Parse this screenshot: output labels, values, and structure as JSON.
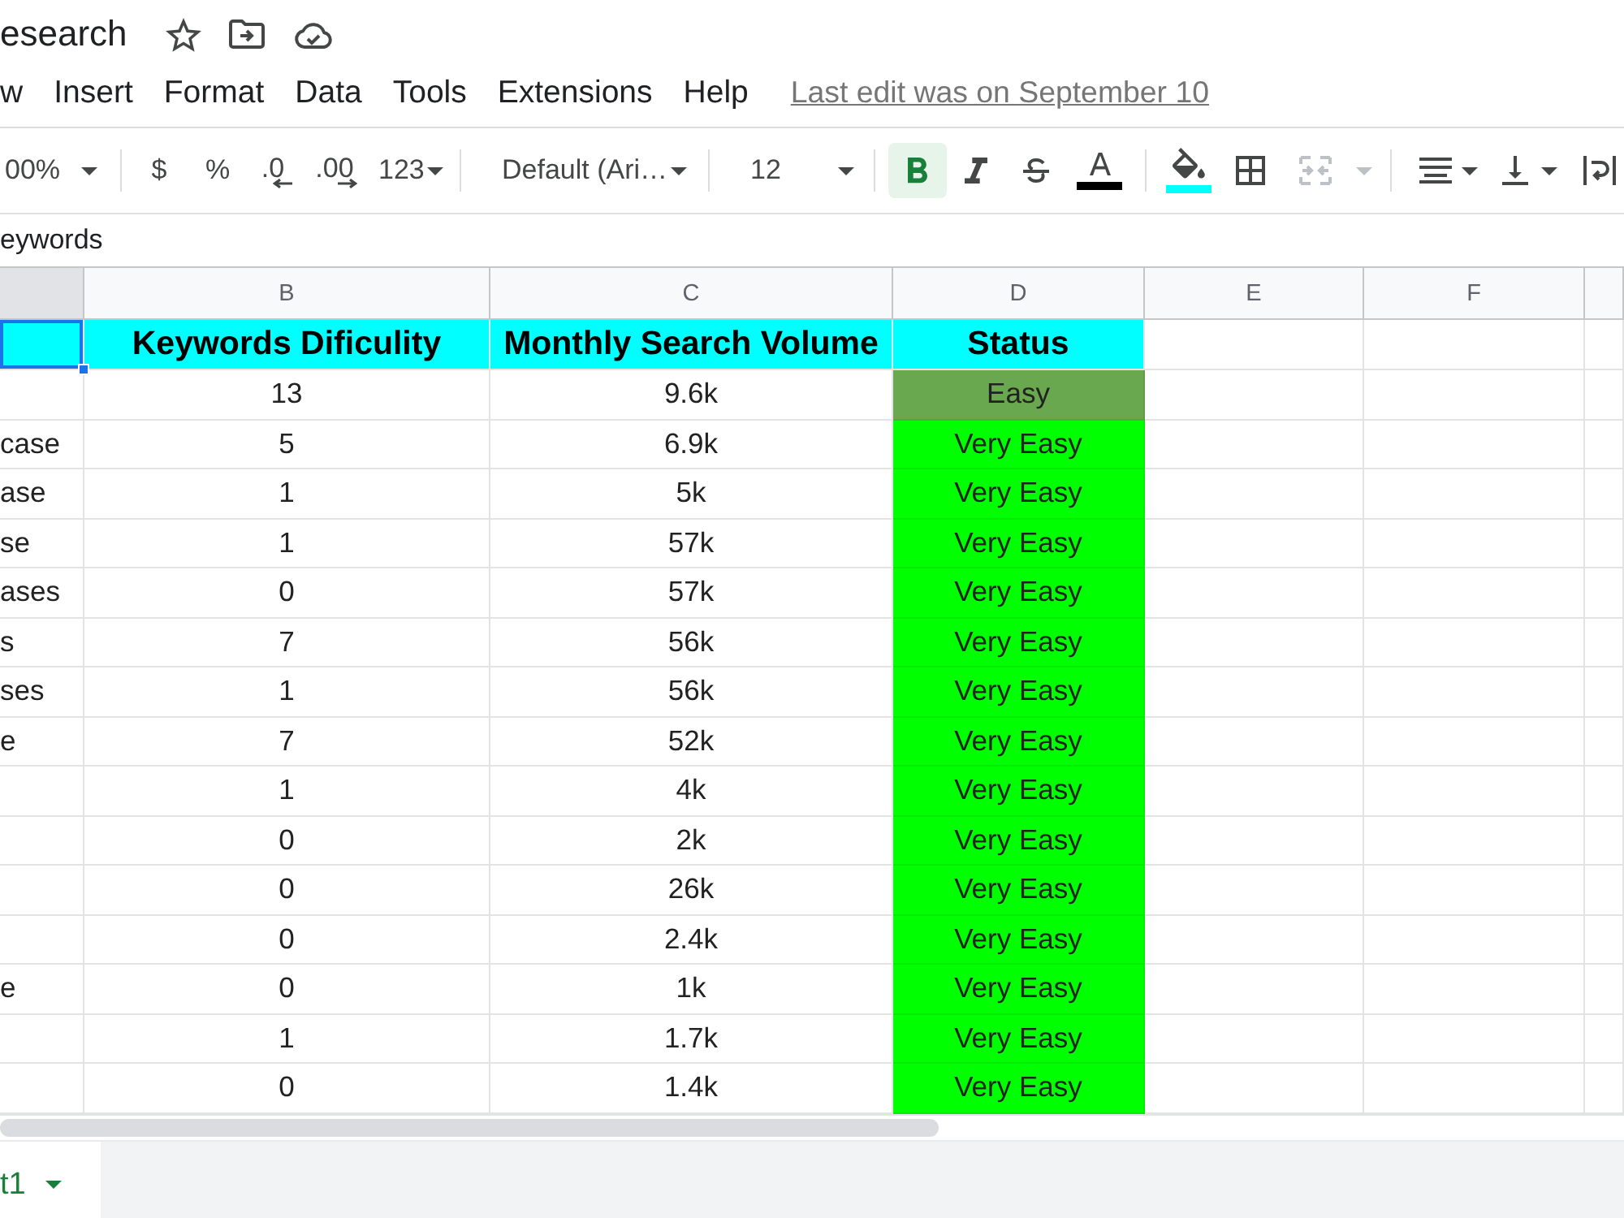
{
  "document": {
    "title": "esearch",
    "starred": false
  },
  "menu": {
    "items": [
      "w",
      "Insert",
      "Format",
      "Data",
      "Tools",
      "Extensions",
      "Help"
    ],
    "last_edit": "Last edit was on September 10"
  },
  "toolbar": [
    {
      "items": [
        {
          "kind": "zoom",
          "label": "00%"
        }
      ]
    },
    {
      "items": [
        {
          "kind": "currency",
          "label": "$"
        },
        {
          "kind": "percent",
          "label": "%"
        },
        {
          "kind": "decrease",
          "label": ".0"
        },
        {
          "kind": "increase",
          "label": ".00"
        },
        {
          "kind": "numberformat",
          "label": "123"
        }
      ]
    },
    {
      "items": [
        {
          "kind": "font",
          "label": "Default (Ari…"
        }
      ]
    },
    {
      "items": [
        {
          "kind": "fontsize",
          "label": "12"
        }
      ]
    },
    {
      "items": [
        {
          "kind": "bold",
          "selected": true
        },
        {
          "kind": "italic",
          "selected": false
        },
        {
          "kind": "strike",
          "selected": false
        },
        {
          "kind": "textcolor",
          "selected": false,
          "color": "#000000"
        }
      ]
    },
    {
      "items": [
        {
          "kind": "fillcolor",
          "disabled": false,
          "color": "#00ffff"
        },
        {
          "kind": "borders",
          "disabled": false
        },
        {
          "kind": "merge",
          "disabled": true
        }
      ]
    },
    {
      "items": [
        {
          "kind": "halign"
        },
        {
          "kind": "valign"
        },
        {
          "kind": "wrap"
        }
      ]
    }
  ],
  "formula_bar": {
    "value": "eywords"
  },
  "columns": [
    {
      "selected": true
    },
    {
      "label": "B",
      "selected": false
    },
    {
      "label": "C",
      "selected": false
    },
    {
      "label": "D",
      "selected": false
    },
    {
      "label": "E",
      "selected": false
    },
    {
      "label": "F",
      "selected": false
    },
    {
      "selected": false
    }
  ],
  "header_row": {
    "first_cell": {
      "selected": true
    },
    "cells": [
      "Keywords Dificulity",
      "Monthly Search Volume",
      "Status"
    ]
  },
  "rows": [
    {
      "difficulty": "13",
      "volume": "9.6k",
      "status": "Easy",
      "color": "#6aa84f"
    },
    {
      "column_a": "case",
      "difficulty": "5",
      "volume": "6.9k",
      "status": "Very Easy",
      "color": "#00ff00"
    },
    {
      "column_a": "ase",
      "difficulty": "1",
      "volume": "5k",
      "status": "Very Easy",
      "color": "#00ff00"
    },
    {
      "column_a": "se",
      "difficulty": "1",
      "volume": "57k",
      "status": "Very Easy",
      "color": "#00ff00"
    },
    {
      "column_a": "ases",
      "difficulty": "0",
      "volume": "57k",
      "status": "Very Easy",
      "color": "#00ff00"
    },
    {
      "column_a": "s",
      "difficulty": "7",
      "volume": "56k",
      "status": "Very Easy",
      "color": "#00ff00"
    },
    {
      "column_a": "ses",
      "difficulty": "1",
      "volume": "56k",
      "status": "Very Easy",
      "color": "#00ff00"
    },
    {
      "column_a": "e",
      "difficulty": "7",
      "volume": "52k",
      "status": "Very Easy",
      "color": "#00ff00"
    },
    {
      "difficulty": "1",
      "volume": "4k",
      "status": "Very Easy",
      "color": "#00ff00"
    },
    {
      "difficulty": "0",
      "volume": "2k",
      "status": "Very Easy",
      "color": "#00ff00"
    },
    {
      "difficulty": "0",
      "volume": "26k",
      "status": "Very Easy",
      "color": "#00ff00"
    },
    {
      "difficulty": "0",
      "volume": "2.4k",
      "status": "Very Easy",
      "color": "#00ff00"
    },
    {
      "column_a": "e",
      "difficulty": "0",
      "volume": "1k",
      "status": "Very Easy",
      "color": "#00ff00"
    },
    {
      "difficulty": "1",
      "volume": "1.7k",
      "status": "Very Easy",
      "color": "#00ff00"
    },
    {
      "difficulty": "0",
      "volume": "1.4k",
      "status": "Very Easy",
      "color": "#00ff00"
    }
  ],
  "sheet_tabs": [
    {
      "label": "t1",
      "selected": true
    }
  ]
}
